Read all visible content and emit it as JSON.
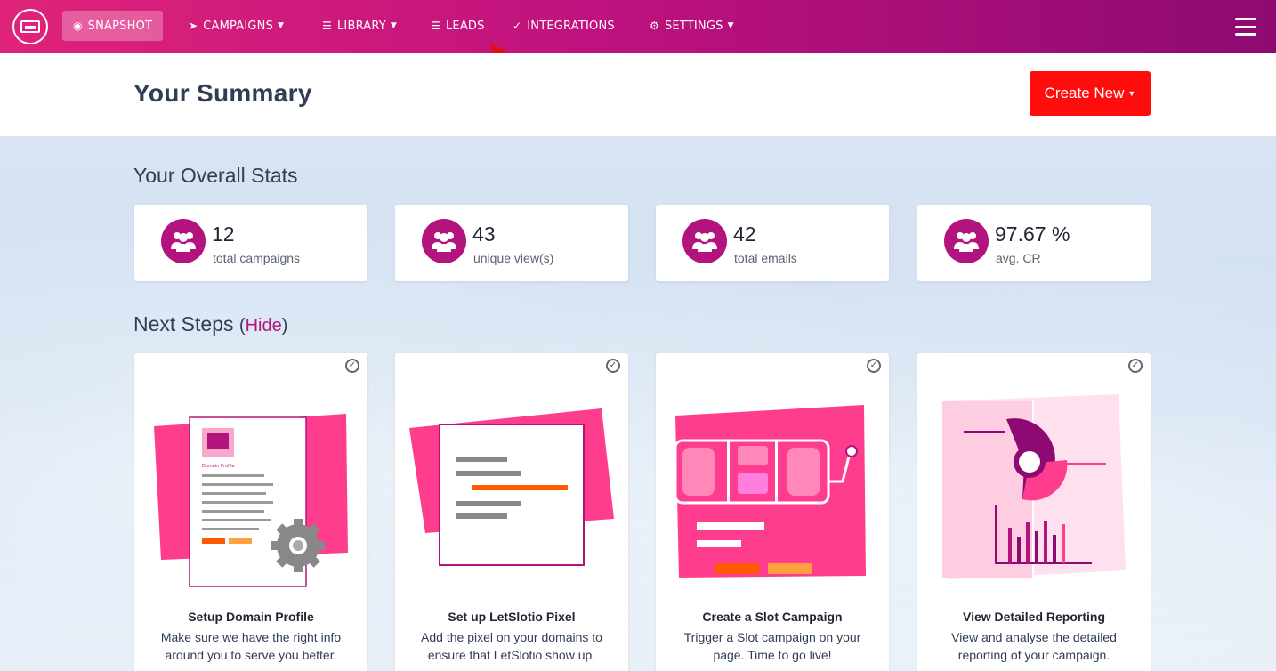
{
  "nav": {
    "items": [
      {
        "label": "SNAPSHOT",
        "icon": "dashboard-icon"
      },
      {
        "label": "CAMPAIGNS",
        "icon": "paper-plane-icon"
      },
      {
        "label": "LIBRARY",
        "icon": "library-icon"
      },
      {
        "label": "LEADS",
        "icon": "list-icon"
      },
      {
        "label": "INTEGRATIONS",
        "icon": "plug-icon"
      },
      {
        "label": "SETTINGS",
        "icon": "gears-icon"
      }
    ],
    "colors": {
      "gradient_start": "#e0237a",
      "gradient_end": "#8e0a72"
    }
  },
  "header": {
    "title": "Your Summary",
    "create_button": "Create New"
  },
  "stats": {
    "title": "Your Overall Stats",
    "cards": [
      {
        "value": "12",
        "label": "total campaigns"
      },
      {
        "value": "43",
        "label": "unique view(s)"
      },
      {
        "value": "42",
        "label": "total emails"
      },
      {
        "value": "97.67 %",
        "label": "avg. CR"
      }
    ]
  },
  "next_steps": {
    "title": "Next Steps",
    "hide_link": "Hide",
    "cards": [
      {
        "title": "Setup Domain Profile",
        "line1": "Make sure we have the right info",
        "line2": "around you to serve you better.",
        "illus_text": "Domain Profile"
      },
      {
        "title": "Set up LetSlotio Pixel",
        "line1": "Add the pixel on your domains to",
        "line2": "ensure that LetSlotio show up."
      },
      {
        "title": "Create a Slot Campaign",
        "line1": "Trigger a Slot campaign on your",
        "line2": "page. Time to go live!"
      },
      {
        "title": "View Detailed Reporting",
        "line1": "View and analyse the detailed",
        "line2": "reporting of your campaign."
      }
    ]
  },
  "accent": {
    "brand": "#b2137d",
    "create": "#ff0d0d",
    "pink": "#ff3d8e",
    "orange": "#ff5a00"
  }
}
